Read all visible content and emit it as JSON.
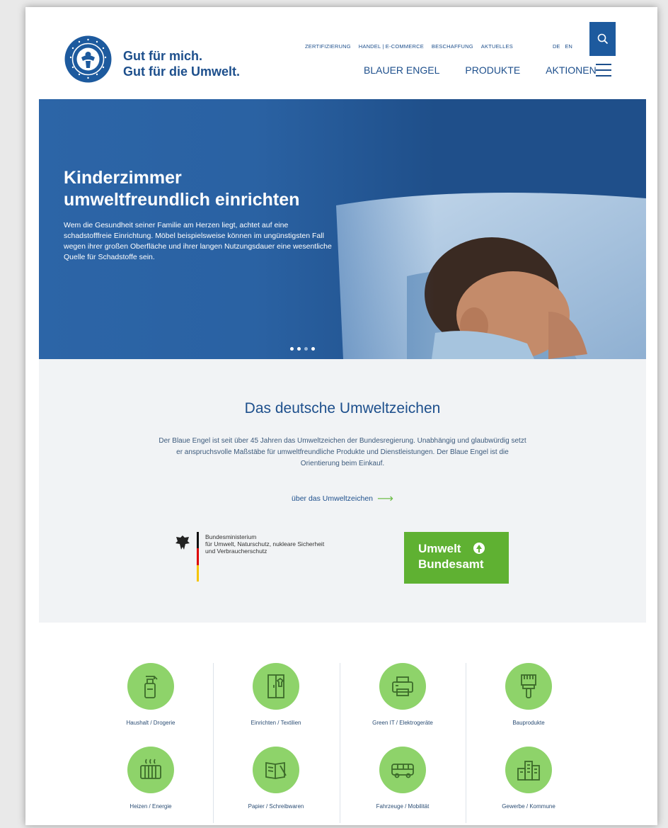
{
  "header": {
    "slogan_line1": "Gut für mich.",
    "slogan_line2": "Gut für die Umwelt.",
    "top_nav": [
      "ZERTIFIZIERUNG",
      "HANDEL | E-COMMERCE",
      "BESCHAFFUNG",
      "AKTUELLES"
    ],
    "languages": [
      "DE",
      "EN"
    ],
    "main_nav": [
      "BLAUER ENGEL",
      "PRODUKTE",
      "AKTIONEN"
    ],
    "search_icon": "search-icon",
    "menu_icon": "hamburger-menu-icon"
  },
  "hero": {
    "title_line1": "Kinderzimmer",
    "title_line2": "umweltfreundlich einrichten",
    "text": "Wem die Gesundheit seiner Familie am Herzen liegt, achtet auf eine schadstofffreie Einrichtung. Möbel beispielsweise können im ungünstigsten Fall wegen ihrer großen Oberfläche und ihrer langen Nutzungsdauer eine wesentliche Quelle für Schadstoffe sein.",
    "slide_count": 4,
    "active_slide": 3
  },
  "umweltzeichen": {
    "title": "Das deutsche Umweltzeichen",
    "text": "Der Blaue Engel ist seit über 45 Jahren das Umweltzeichen der Bundesregierung. Unabhängig und glaubwürdig setzt er anspruchsvolle Maßstäbe für umweltfreundliche Produkte und Dienstleistungen. Der Blaue Engel ist die Orientierung beim Einkauf.",
    "link": "über das Umweltzeichen",
    "bmu_line1": "Bundesministerium",
    "bmu_line2": "für Umwelt, Naturschutz, nukleare Sicherheit",
    "bmu_line3": "und Verbraucherschutz",
    "uba_line1": "Umwelt",
    "uba_line2": "Bundesamt"
  },
  "categories": [
    {
      "label": "Haushalt / Drogerie",
      "icon": "spray-bottle-icon"
    },
    {
      "label": "Einrichten / Textilien",
      "icon": "wardrobe-icon"
    },
    {
      "label": "Green IT / Elektrogeräte",
      "icon": "printer-icon"
    },
    {
      "label": "Bauprodukte",
      "icon": "paint-brush-icon"
    },
    {
      "label": "Heizen / Energie",
      "icon": "radiator-icon"
    },
    {
      "label": "Papier / Schreibwaren",
      "icon": "notebook-icon"
    },
    {
      "label": "Fahrzeuge / Mobilität",
      "icon": "bus-icon"
    },
    {
      "label": "Gewerbe / Kommune",
      "icon": "buildings-icon"
    }
  ],
  "colors": {
    "brand_blue": "#1d4f8c",
    "search_bg": "#1d5a9e",
    "category_green": "#8ed36a",
    "uba_green": "#5fb132",
    "link_arrow": "#6fbe4a"
  }
}
